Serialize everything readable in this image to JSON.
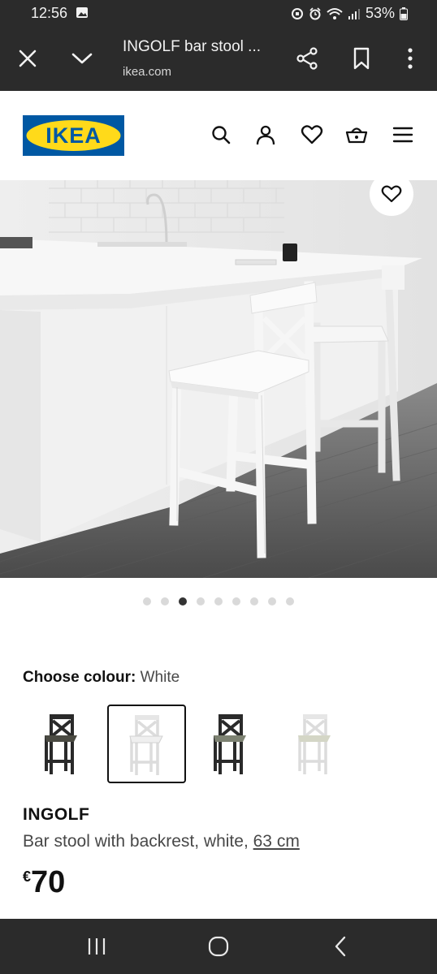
{
  "status_bar": {
    "time": "12:56",
    "battery": "53%",
    "icons": [
      "gallery-icon",
      "data-saver-icon",
      "alarm-icon",
      "wifi-icon",
      "signal-icon",
      "battery-icon"
    ]
  },
  "browser": {
    "page_title": "INGOLF bar stool ...",
    "url": "ikea.com",
    "icons": [
      "close-icon",
      "chevron-down-icon",
      "share-icon",
      "bookmark-icon",
      "more-vert-icon"
    ]
  },
  "header": {
    "logo_text": "IKEA",
    "icons": [
      "search-icon",
      "account-icon",
      "heart-icon",
      "basket-icon",
      "menu-icon"
    ],
    "colors": {
      "logo_blue": "#0058A3",
      "logo_yellow": "#FFDA1A"
    }
  },
  "gallery": {
    "image_count": 9,
    "active_index": 2
  },
  "colour_chooser": {
    "label": "Choose colour:",
    "selected_value": "White",
    "options": [
      {
        "icon": "stool-black-brown-icon",
        "selected": false
      },
      {
        "icon": "stool-white-icon",
        "selected": true
      },
      {
        "icon": "stool-dark-gray-icon",
        "selected": false
      },
      {
        "icon": "stool-white-beige-icon",
        "selected": false
      }
    ]
  },
  "product": {
    "name": "INGOLF",
    "description": "Bar stool with backrest, white,",
    "size_link": "63 cm",
    "currency": "€",
    "price": "70"
  },
  "nav_bar": {
    "icons": [
      "recents-icon",
      "home-icon",
      "back-icon"
    ]
  }
}
